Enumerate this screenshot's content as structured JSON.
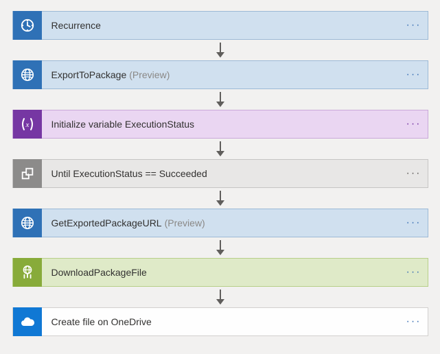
{
  "steps": [
    {
      "id": "recurrence",
      "label": "Recurrence",
      "suffix": "",
      "variant": "blue",
      "icon": "clock"
    },
    {
      "id": "export-to-package",
      "label": "ExportToPackage",
      "suffix": "(Preview)",
      "variant": "blue",
      "icon": "globe"
    },
    {
      "id": "initialize-variable",
      "label": "Initialize variable ExecutionStatus",
      "suffix": "",
      "variant": "purple",
      "icon": "var"
    },
    {
      "id": "until-loop",
      "label": "Until ExecutionStatus == Succeeded",
      "suffix": "",
      "variant": "grey",
      "icon": "loop"
    },
    {
      "id": "get-exported-package-url",
      "label": "GetExportedPackageURL",
      "suffix": "(Preview)",
      "variant": "blue",
      "icon": "globe"
    },
    {
      "id": "download-package-file",
      "label": "DownloadPackageFile",
      "suffix": "",
      "variant": "green",
      "icon": "download"
    },
    {
      "id": "create-file-onedrive",
      "label": "Create file on OneDrive",
      "suffix": "",
      "variant": "white",
      "icon": "cloud"
    }
  ],
  "menu_glyph": "···"
}
